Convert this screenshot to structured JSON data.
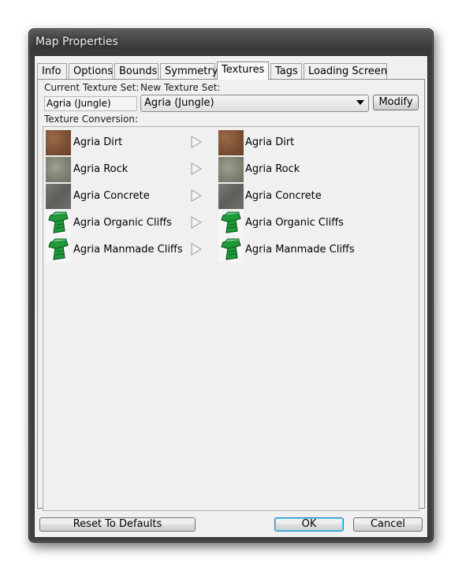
{
  "window": {
    "title": "Map Properties"
  },
  "tabs": [
    {
      "label": "Info"
    },
    {
      "label": "Options"
    },
    {
      "label": "Bounds"
    },
    {
      "label": "Symmetry"
    },
    {
      "label": "Textures"
    },
    {
      "label": "Tags"
    },
    {
      "label": "Loading Screen"
    }
  ],
  "active_tab": "Textures",
  "textures": {
    "current_label": "Current Texture Set:",
    "current_value": "Agria (Jungle)",
    "new_label": "New Texture Set:",
    "new_value": "Agria (Jungle)",
    "modify_label": "Modify",
    "conversion_label": "Texture Conversion:",
    "rows": [
      {
        "from": "Agria Dirt",
        "to": "Agria Dirt",
        "icon": "dirt-texture-icon"
      },
      {
        "from": "Agria Rock",
        "to": "Agria Rock",
        "icon": "rock-texture-icon"
      },
      {
        "from": "Agria Concrete",
        "to": "Agria Concrete",
        "icon": "concrete-texture-icon"
      },
      {
        "from": "Agria Organic Cliffs",
        "to": "Agria Organic Cliffs",
        "icon": "organic-cliff-icon"
      },
      {
        "from": "Agria Manmade Cliffs",
        "to": "Agria Manmade Cliffs",
        "icon": "manmade-cliff-icon"
      }
    ]
  },
  "footer": {
    "reset_label": "Reset To Defaults",
    "ok_label": "OK",
    "cancel_label": "Cancel"
  },
  "colors": {
    "cliff_green": "#1f9a3a",
    "default_button_border": "#3c7fb1"
  }
}
